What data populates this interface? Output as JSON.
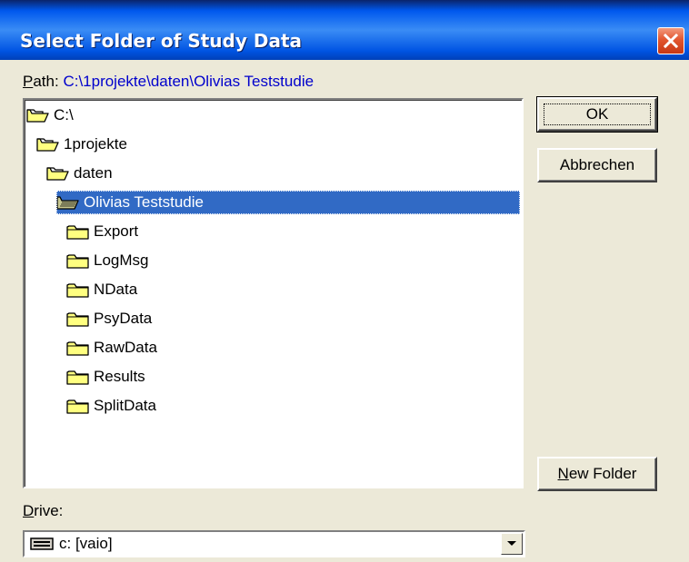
{
  "window": {
    "title": "Select Folder of Study Data",
    "close_icon": "close-icon"
  },
  "path": {
    "label": "Path:",
    "value": "C:\\1projekte\\daten\\Olivias Teststudie"
  },
  "tree": {
    "nodes": [
      {
        "label": "C:\\",
        "icon": "open-folder-icon"
      },
      {
        "label": "1projekte",
        "icon": "open-folder-icon"
      },
      {
        "label": "daten",
        "icon": "open-folder-icon"
      },
      {
        "label": "Olivias Teststudie",
        "icon": "open-folder-icon",
        "selected": true
      },
      {
        "label": "Export",
        "icon": "folder-icon"
      },
      {
        "label": "LogMsg",
        "icon": "folder-icon"
      },
      {
        "label": "NData",
        "icon": "folder-icon"
      },
      {
        "label": "PsyData",
        "icon": "folder-icon"
      },
      {
        "label": "RawData",
        "icon": "folder-icon"
      },
      {
        "label": "Results",
        "icon": "folder-icon"
      },
      {
        "label": "SplitData",
        "icon": "folder-icon"
      }
    ]
  },
  "buttons": {
    "ok": "OK",
    "cancel": "Abbrechen",
    "new_folder": "New Folder"
  },
  "drive": {
    "label": "Drive:",
    "value": "c: [vaio]",
    "icon": "hard-drive-icon"
  },
  "colors": {
    "title_bar": "#0058ee",
    "selection": "#316ac5",
    "dialog_bg": "#ece9d8",
    "folder_yellow": "#ffff80"
  }
}
